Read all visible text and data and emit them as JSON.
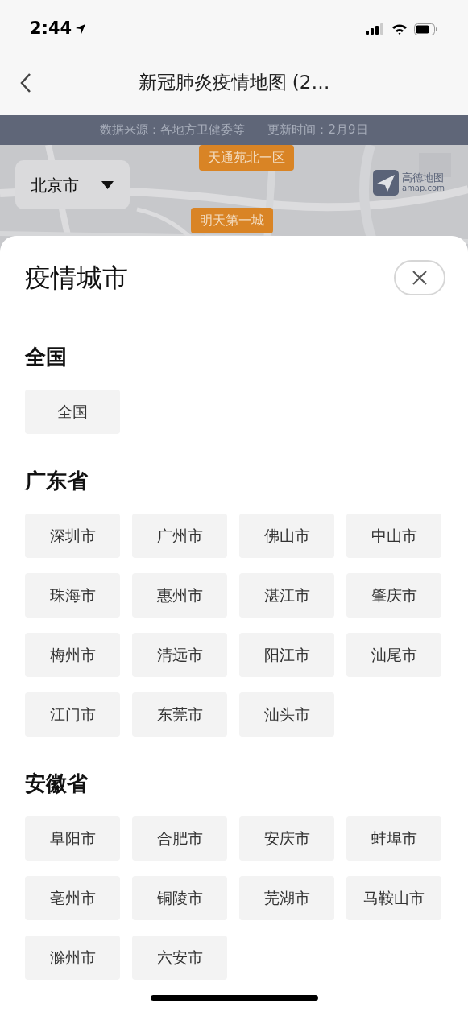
{
  "status_bar": {
    "time": "2:44"
  },
  "nav": {
    "title": "新冠肺炎疫情地图 (2…"
  },
  "banner": {
    "source": "数据来源：各地方卫健委等",
    "updated": "更新时间：2月9日"
  },
  "map": {
    "city_selector": "北京市",
    "markers": [
      "天通苑北一区",
      "明天第一城"
    ],
    "logo": {
      "name": "高德地图",
      "domain": "amap.com"
    }
  },
  "sheet": {
    "title": "疫情城市",
    "sections": [
      {
        "title": "全国",
        "cities": [
          "全国"
        ]
      },
      {
        "title": "广东省",
        "cities": [
          "深圳市",
          "广州市",
          "佛山市",
          "中山市",
          "珠海市",
          "惠州市",
          "湛江市",
          "肇庆市",
          "梅州市",
          "清远市",
          "阳江市",
          "汕尾市",
          "江门市",
          "东莞市",
          "汕头市"
        ]
      },
      {
        "title": "安徽省",
        "cities": [
          "阜阳市",
          "合肥市",
          "安庆市",
          "蚌埠市",
          "亳州市",
          "铜陵市",
          "芜湖市",
          "马鞍山市",
          "滁州市",
          "六安市"
        ]
      }
    ]
  }
}
